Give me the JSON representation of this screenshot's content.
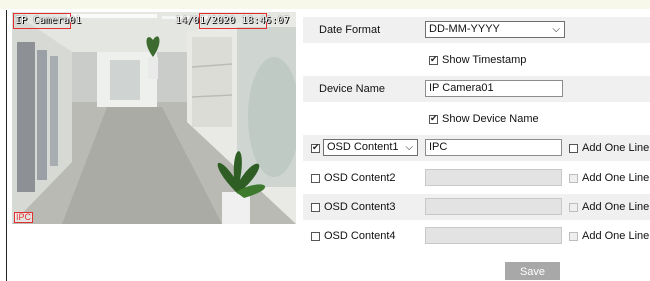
{
  "preview": {
    "osd_device_name": "IP Camera01",
    "osd_timestamp": "14/01/2020 18:46:07",
    "ipc_mark": "IPC"
  },
  "form": {
    "date_format_label": "Date Format",
    "date_format_value": "DD-MM-YYYY",
    "show_timestamp_label": "Show Timestamp",
    "show_timestamp_checked": true,
    "device_name_label": "Device Name",
    "device_name_value": "IP Camera01",
    "show_device_name_label": "Show Device Name",
    "show_device_name_checked": true,
    "osd_rows": [
      {
        "label": "OSD Content1",
        "is_select": true,
        "checked": true,
        "value": "IPC",
        "add_line": "Add One Line",
        "enabled": true
      },
      {
        "label": "OSD Content2",
        "is_select": false,
        "checked": false,
        "value": "",
        "add_line": "Add One Line",
        "enabled": false
      },
      {
        "label": "OSD Content3",
        "is_select": false,
        "checked": false,
        "value": "",
        "add_line": "Add One Line",
        "enabled": false
      },
      {
        "label": "OSD Content4",
        "is_select": false,
        "checked": false,
        "value": "",
        "add_line": "Add One Line",
        "enabled": false
      }
    ],
    "save_label": "Save"
  },
  "icons": {
    "dropdown": "chevron-down-icon",
    "check": "checkmark-icon"
  },
  "colors": {
    "osd_box": "#e23030",
    "row_shade": "#f0f0f0",
    "save_button": "#a8a8a8"
  }
}
